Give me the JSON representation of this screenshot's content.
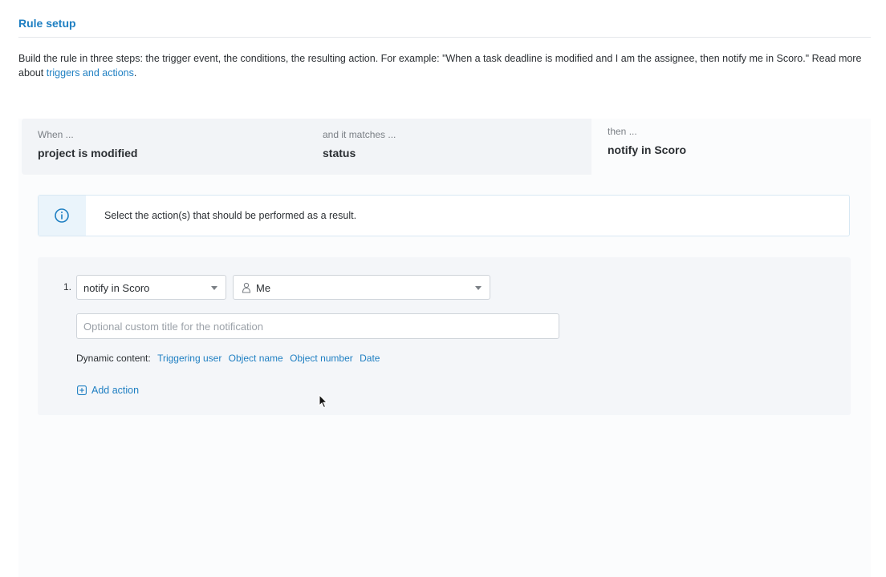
{
  "section": {
    "title": "Rule setup"
  },
  "intro": {
    "text": "Build the rule in three steps: the trigger event, the conditions, the resulting action. For example: \"When a task deadline is modified and I am the assignee, then notify me in Scoro.\" Read more about ",
    "link": "triggers and actions",
    "suffix": "."
  },
  "steps": {
    "when": {
      "caption": "When ...",
      "value": "project is modified"
    },
    "match": {
      "caption": "and it matches ...",
      "value": "status"
    },
    "then": {
      "caption": "then ...",
      "value": "notify in Scoro"
    }
  },
  "info": {
    "icon": "info-icon",
    "message": "Select the action(s) that should be performed as a result."
  },
  "action": {
    "number": "1.",
    "type_value": "notify in Scoro",
    "recipient_icon": "user-icon",
    "recipient_value": "Me",
    "title_placeholder": "Optional custom title for the notification",
    "title_value": "",
    "dynamic_label": "Dynamic content:",
    "dynamic_items": [
      "Triggering user",
      "Object name",
      "Object number",
      "Date"
    ],
    "add_label": "Add action",
    "add_icon": "plus-square-icon"
  },
  "colors": {
    "accent": "#1e7fc2",
    "info_bg": "#eaf4fb",
    "steps_bg": "#f2f4f7",
    "action_bg": "#f4f6f9"
  }
}
